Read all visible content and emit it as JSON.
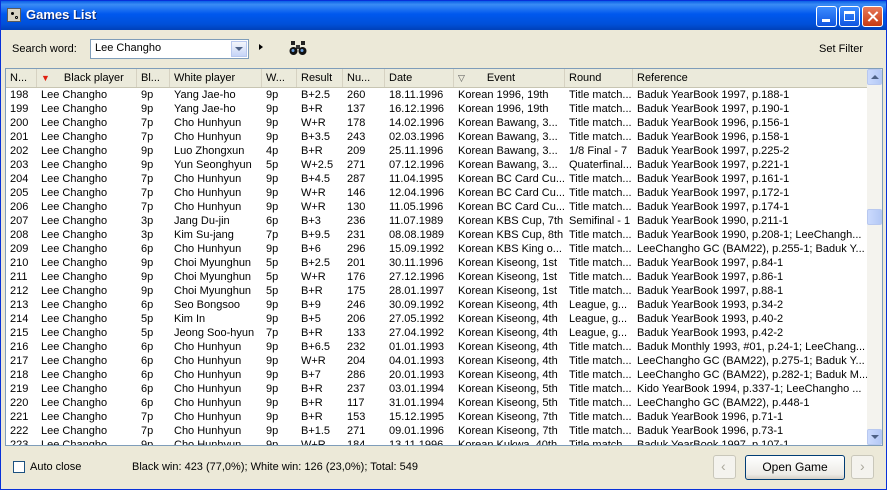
{
  "window": {
    "title": "Games List"
  },
  "toolbar": {
    "search_label": "Search word:",
    "search_value": "Lee Changho",
    "set_filter": "Set Filter"
  },
  "columns": [
    "N...",
    "Black player",
    "Bl...",
    "White player",
    "W...",
    "Result",
    "Nu...",
    "Date",
    "Event",
    "Round",
    "Reference"
  ],
  "rows": [
    [
      "198",
      "Lee Changho",
      "9p",
      "Yang Jae-ho",
      "9p",
      "B+2.5",
      "260",
      "18.11.1996",
      "Korean 1996, 19th",
      "Title match...",
      "Baduk YearBook 1997, p.188-1"
    ],
    [
      "199",
      "Lee Changho",
      "9p",
      "Yang Jae-ho",
      "9p",
      "B+R",
      "137",
      "16.12.1996",
      "Korean 1996, 19th",
      "Title match...",
      "Baduk YearBook 1997, p.190-1"
    ],
    [
      "200",
      "Lee Changho",
      "7p",
      "Cho Hunhyun",
      "9p",
      "W+R",
      "178",
      "14.02.1996",
      "Korean Bawang, 3...",
      "Title match...",
      "Baduk YearBook 1996, p.156-1"
    ],
    [
      "201",
      "Lee Changho",
      "7p",
      "Cho Hunhyun",
      "9p",
      "B+3.5",
      "243",
      "02.03.1996",
      "Korean Bawang, 3...",
      "Title match...",
      "Baduk YearBook 1996, p.158-1"
    ],
    [
      "202",
      "Lee Changho",
      "9p",
      "Luo Zhongxun",
      "4p",
      "B+R",
      "209",
      "25.11.1996",
      "Korean Bawang, 3...",
      "1/8 Final - 7",
      "Baduk YearBook 1997, p.225-2"
    ],
    [
      "203",
      "Lee Changho",
      "9p",
      "Yun Seonghyun",
      "5p",
      "W+2.5",
      "271",
      "07.12.1996",
      "Korean Bawang, 3...",
      "Quaterfinal...",
      "Baduk YearBook 1997, p.221-1"
    ],
    [
      "204",
      "Lee Changho",
      "7p",
      "Cho Hunhyun",
      "9p",
      "B+4.5",
      "287",
      "11.04.1995",
      "Korean BC Card Cu...",
      "Title match...",
      "Baduk YearBook 1997, p.161-1"
    ],
    [
      "205",
      "Lee Changho",
      "7p",
      "Cho Hunhyun",
      "9p",
      "W+R",
      "146",
      "12.04.1996",
      "Korean BC Card Cu...",
      "Title match...",
      "Baduk YearBook 1997, p.172-1"
    ],
    [
      "206",
      "Lee Changho",
      "7p",
      "Cho Hunhyun",
      "9p",
      "W+R",
      "130",
      "11.05.1996",
      "Korean BC Card Cu...",
      "Title match...",
      "Baduk YearBook 1997, p.174-1"
    ],
    [
      "207",
      "Lee Changho",
      "3p",
      "Jang Du-jin",
      "6p",
      "B+3",
      "236",
      "11.07.1989",
      "Korean KBS Cup, 7th",
      "Semifinal - 1",
      "Baduk YearBook 1990, p.211-1"
    ],
    [
      "208",
      "Lee Changho",
      "3p",
      "Kim Su-jang",
      "7p",
      "B+9.5",
      "231",
      "08.08.1989",
      "Korean KBS Cup, 8th",
      "Title match...",
      "Baduk YearBook 1990, p.208-1; LeeChangh..."
    ],
    [
      "209",
      "Lee Changho",
      "6p",
      "Cho Hunhyun",
      "9p",
      "B+6",
      "296",
      "15.09.1992",
      "Korean KBS King o...",
      "Title match...",
      "LeeChangho GC (BAM22), p.255-1; Baduk Y..."
    ],
    [
      "210",
      "Lee Changho",
      "9p",
      "Choi Myunghun",
      "5p",
      "B+2.5",
      "201",
      "30.11.1996",
      "Korean Kiseong, 1st",
      "Title match...",
      "Baduk YearBook 1997, p.84-1"
    ],
    [
      "211",
      "Lee Changho",
      "9p",
      "Choi Myunghun",
      "5p",
      "W+R",
      "176",
      "27.12.1996",
      "Korean Kiseong, 1st",
      "Title match...",
      "Baduk YearBook 1997, p.86-1"
    ],
    [
      "212",
      "Lee Changho",
      "9p",
      "Choi Myunghun",
      "5p",
      "B+R",
      "175",
      "28.01.1997",
      "Korean Kiseong, 1st",
      "Title match...",
      "Baduk YearBook 1997, p.88-1"
    ],
    [
      "213",
      "Lee Changho",
      "6p",
      "Seo Bongsoo",
      "9p",
      "B+9",
      "246",
      "30.09.1992",
      "Korean Kiseong, 4th",
      "League, g...",
      "Baduk YearBook 1993, p.34-2"
    ],
    [
      "214",
      "Lee Changho",
      "5p",
      "Kim In",
      "9p",
      "B+5",
      "206",
      "27.05.1992",
      "Korean Kiseong, 4th",
      "League, g...",
      "Baduk YearBook 1993, p.40-2"
    ],
    [
      "215",
      "Lee Changho",
      "5p",
      "Jeong Soo-hyun",
      "7p",
      "B+R",
      "133",
      "27.04.1992",
      "Korean Kiseong, 4th",
      "League, g...",
      "Baduk YearBook 1993, p.42-2"
    ],
    [
      "216",
      "Lee Changho",
      "6p",
      "Cho Hunhyun",
      "9p",
      "B+6.5",
      "232",
      "01.01.1993",
      "Korean Kiseong, 4th",
      "Title match...",
      "Baduk Monthly 1993, #01, p.24-1; LeeChang..."
    ],
    [
      "217",
      "Lee Changho",
      "6p",
      "Cho Hunhyun",
      "9p",
      "W+R",
      "204",
      "04.01.1993",
      "Korean Kiseong, 4th",
      "Title match...",
      "LeeChangho GC (BAM22), p.275-1; Baduk Y..."
    ],
    [
      "218",
      "Lee Changho",
      "6p",
      "Cho Hunhyun",
      "9p",
      "B+7",
      "286",
      "20.01.1993",
      "Korean Kiseong, 4th",
      "Title match...",
      "LeeChangho GC (BAM22), p.282-1; Baduk M..."
    ],
    [
      "219",
      "Lee Changho",
      "6p",
      "Cho Hunhyun",
      "9p",
      "B+R",
      "237",
      "03.01.1994",
      "Korean Kiseong, 5th",
      "Title match...",
      "Kido YearBook 1994, p.337-1; LeeChangho ..."
    ],
    [
      "220",
      "Lee Changho",
      "6p",
      "Cho Hunhyun",
      "9p",
      "B+R",
      "117",
      "31.01.1994",
      "Korean Kiseong, 5th",
      "Title match...",
      "LeeChangho GC (BAM22), p.448-1"
    ],
    [
      "221",
      "Lee Changho",
      "7p",
      "Cho Hunhyun",
      "9p",
      "B+R",
      "153",
      "15.12.1995",
      "Korean Kiseong, 7th",
      "Title match...",
      "Baduk YearBook 1996, p.71-1"
    ],
    [
      "222",
      "Lee Changho",
      "7p",
      "Cho Hunhyun",
      "9p",
      "B+1.5",
      "271",
      "09.01.1996",
      "Korean Kiseong, 7th",
      "Title match...",
      "Baduk YearBook 1996, p.73-1"
    ],
    [
      "223",
      "Lee Changho",
      "9p",
      "Cho Hunhyun",
      "9p",
      "W+R",
      "184",
      "13.11.1996",
      "Korean Kukwa, 40th",
      "Title match...",
      "Baduk YearBook 1997, p.107-1"
    ]
  ],
  "footer": {
    "auto_close": "Auto close",
    "status": "Black win: 423 (77,0%); White win: 126 (23,0%); Total: 549",
    "open_game": "Open Game"
  },
  "sorted_columns": [
    "Black player",
    "Event"
  ],
  "colors": {
    "titlebar": "#0058ee",
    "sort_arrow": "#e02010",
    "header": "#ebeadb"
  }
}
